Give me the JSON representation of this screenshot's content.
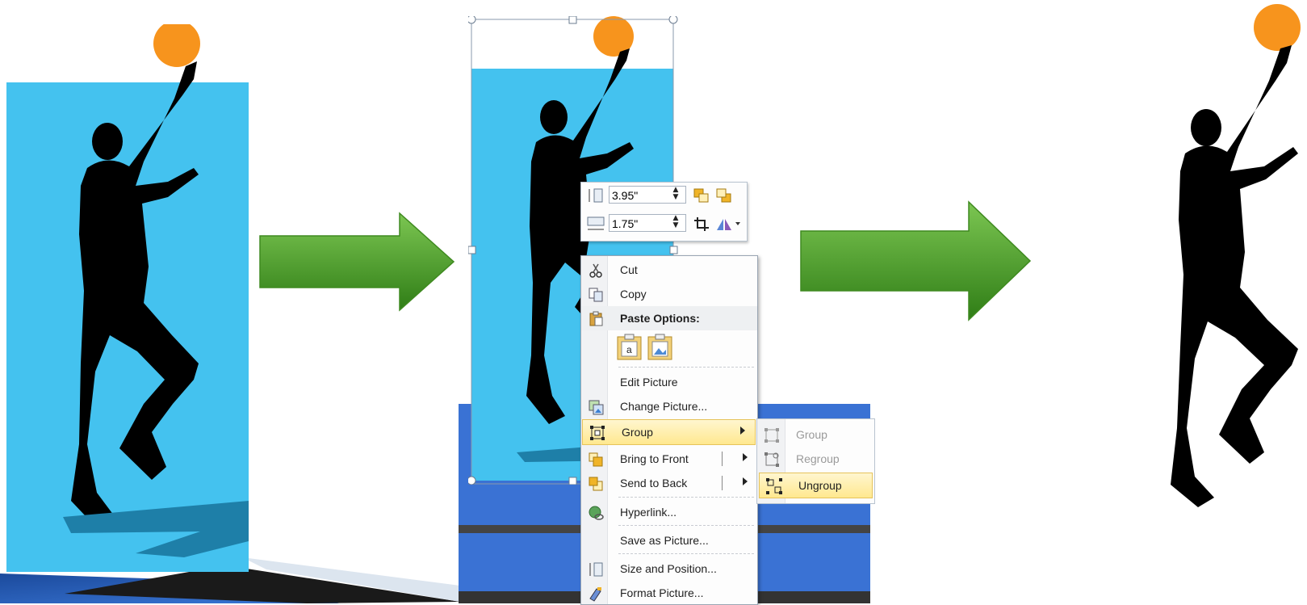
{
  "mini_toolbar": {
    "height_value": "3.95\"",
    "width_value": "1.75\""
  },
  "context_menu": {
    "items": [
      {
        "label": "Cut",
        "icon": "scissors-icon"
      },
      {
        "label": "Copy",
        "icon": "copy-icon"
      },
      {
        "label": "Paste Options:",
        "icon": "clipboard-icon"
      },
      {
        "label": "Edit Picture"
      },
      {
        "label": "Change Picture...",
        "icon": "change-picture-icon"
      },
      {
        "label": "Group",
        "icon": "group-icon"
      },
      {
        "label": "Bring to Front",
        "icon": "bring-to-front-icon"
      },
      {
        "label": "Send to Back",
        "icon": "send-to-back-icon"
      },
      {
        "label": "Hyperlink...",
        "icon": "hyperlink-icon"
      },
      {
        "label": "Save as Picture..."
      },
      {
        "label": "Size and Position...",
        "icon": "size-position-icon"
      },
      {
        "label": "Format Picture...",
        "icon": "format-picture-icon"
      }
    ]
  },
  "group_submenu": {
    "items": [
      {
        "label": "Group",
        "enabled": false,
        "icon": "group-icon"
      },
      {
        "label": "Regroup",
        "enabled": false,
        "icon": "regroup-icon"
      },
      {
        "label": "Ungroup",
        "enabled": true,
        "icon": "ungroup-icon"
      }
    ]
  },
  "colors": {
    "sky_blue": "#44c2ef",
    "ball_orange": "#f7941d",
    "arrow_green": "#4ea82a",
    "highlight": "#ffe88f"
  }
}
